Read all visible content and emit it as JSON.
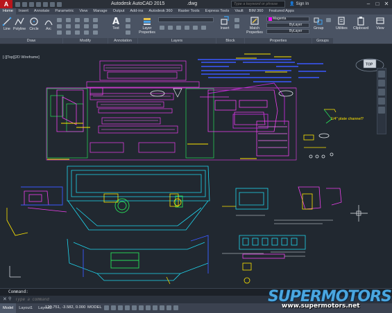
{
  "app": {
    "logo": "A",
    "title": "Autodesk AutoCAD 2015",
    "file": ".dwg",
    "search_placeholder": "Type a keyword or phrase",
    "signin": "Sign In",
    "window_controls": [
      "–",
      "□",
      "✕"
    ]
  },
  "tabs": [
    "Home",
    "Insert",
    "Annotate",
    "Parametric",
    "View",
    "Manage",
    "Output",
    "Add-ins",
    "Autodesk 360",
    "Raster Tools",
    "Express Tools",
    "Vault",
    "BIM 360",
    "Featured Apps"
  ],
  "active_tab": "Home",
  "ribbon": {
    "draw": {
      "title": "Draw",
      "tools": [
        "Line",
        "Polyline",
        "Circle",
        "Arc"
      ]
    },
    "modify": {
      "title": "Modify"
    },
    "annotation": {
      "title": "Annotation",
      "tools": [
        "Text"
      ]
    },
    "layers": {
      "title": "Layers",
      "tools": [
        "Layer Properties"
      ]
    },
    "block": {
      "title": "Block",
      "tools": [
        "Insert"
      ]
    },
    "properties": {
      "title": "Properties",
      "tools": [
        "Match Properties"
      ],
      "color": "Magenta",
      "linetype": "ByLayer",
      "lineweight": "ByLayer",
      "color_hex": "#ff00ff"
    },
    "groups": {
      "title": "Groups",
      "tools": [
        "Group"
      ]
    },
    "utilities": {
      "tools": [
        "Utilities"
      ]
    },
    "clipboard": {
      "tools": [
        "Clipboard"
      ]
    },
    "view": {
      "tools": [
        "View"
      ]
    }
  },
  "viewport": {
    "label": "[-][Top][2D Wireframe]",
    "viewcube_label": "TOP",
    "annotation": "1/4\" plate channel?"
  },
  "command": {
    "history": "Command:",
    "placeholder": "Type a command"
  },
  "status": {
    "tabs": [
      "Model",
      "Layout1",
      "Layout2"
    ],
    "coords": "120.751, -3.582, 0.000",
    "space": "MODEL"
  },
  "watermark": {
    "logo": "SUPERMOTORS",
    "url": "www.supermotors.net"
  },
  "colors": {
    "background": "#212830",
    "magenta": "#ff00ff",
    "cyan": "#00e5ff",
    "green": "#00ff3c",
    "yellow": "#ffe600",
    "blue": "#3050ff"
  }
}
